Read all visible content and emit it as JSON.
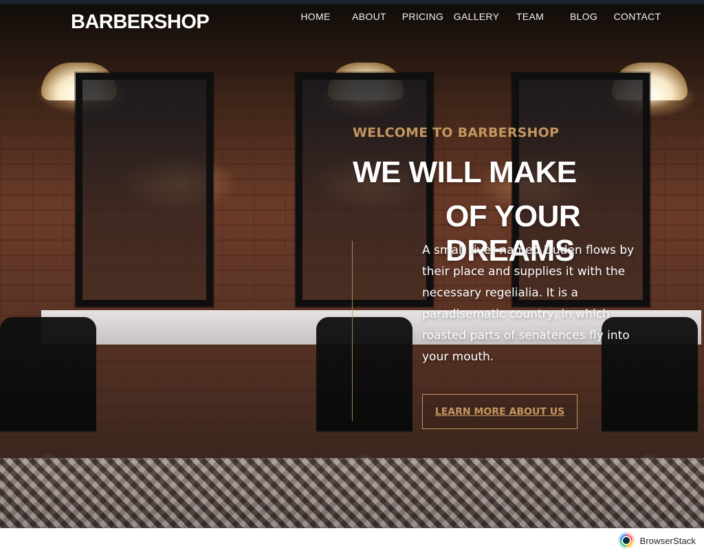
{
  "nav": {
    "brand": "BARBERSHOP",
    "items": [
      {
        "label": "HOME"
      },
      {
        "label": "ABOUT"
      },
      {
        "label": "PRICING"
      },
      {
        "label": "GALLERY"
      },
      {
        "label": "TEAM"
      },
      {
        "label": "BLOG"
      },
      {
        "label": "CONTACT"
      }
    ]
  },
  "hero": {
    "kicker": "WELCOME TO BARBERSHOP",
    "headline_line1": "WE WILL MAKE",
    "headline_line2": "OF YOUR DREAMS",
    "description": "A small river named Duden flows by their place and supplies it with the necessary regelialia. It is a paradisematic country, in which roasted parts of senatences fly into your mouth.",
    "cta_label": "LEARN MORE ABOUT US",
    "colors": {
      "accent": "#c4965f",
      "text": "#ffffff"
    }
  },
  "badge": {
    "label": "BrowserStack",
    "icon": "browserstack-icon"
  }
}
